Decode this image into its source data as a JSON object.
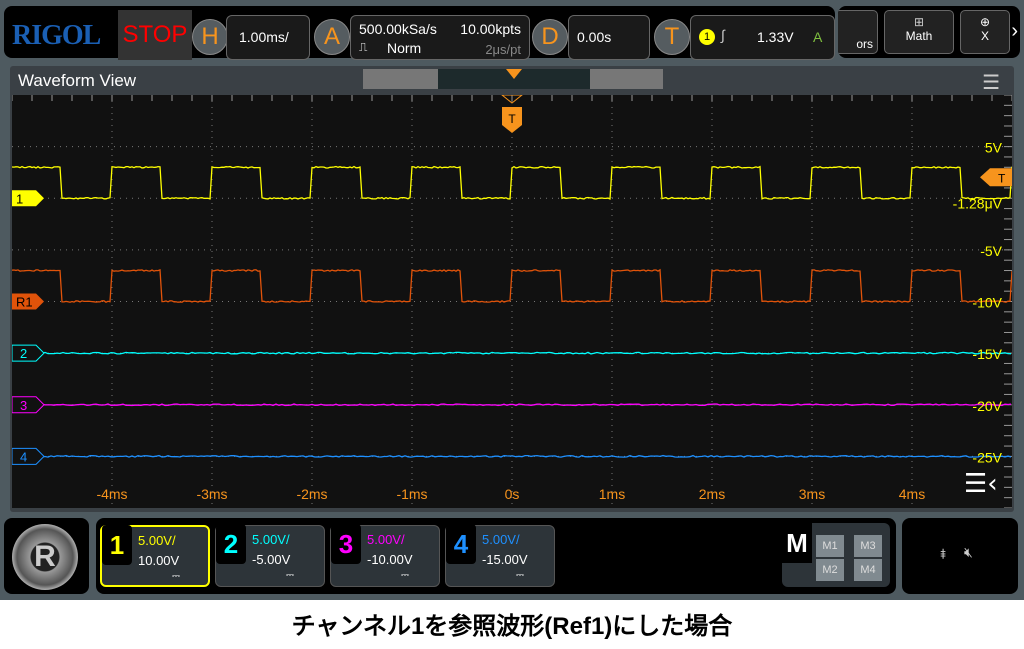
{
  "header": {
    "logo": "RIGOL",
    "run_state": "STOP",
    "h_label": "H",
    "timebase": "1.00ms/",
    "a_label": "A",
    "sample_rate": "500.00kSa/s",
    "memory_depth": "10.00kpts",
    "acq_mode": "Norm",
    "sample_interval": "2μs/pt",
    "d_label": "D",
    "delay": "0.00s",
    "t_label": "T",
    "trigger_source": "1",
    "trigger_level": "1.33V",
    "trigger_status": "A",
    "right_buttons": [
      "ors",
      "Math",
      "X"
    ]
  },
  "waveform_view": {
    "title": "Waveform View",
    "trigger_marker": "T",
    "ch1_label": "1",
    "ref_label": "R1",
    "ch2_label": "2",
    "ch3_label": "3",
    "ch4_label": "4",
    "trigger_level_label": "-1.28μV",
    "volt_labels": [
      "5V",
      "-5V",
      "-10V",
      "-15V",
      "-20V",
      "-25V"
    ],
    "time_labels": [
      "-4ms",
      "-3ms",
      "-2ms",
      "-1ms",
      "0s",
      "1ms",
      "2ms",
      "3ms",
      "4ms"
    ]
  },
  "channels": [
    {
      "num": "1",
      "scale": "5.00V/",
      "offset": "10.00V",
      "coupling": "DC",
      "color": "#ffff00",
      "active": true
    },
    {
      "num": "2",
      "scale": "5.00V/",
      "offset": "-5.00V",
      "coupling": "DC",
      "color": "#00ffff"
    },
    {
      "num": "3",
      "scale": "5.00V/",
      "offset": "-10.00V",
      "coupling": "DC",
      "color": "#ff00ff"
    },
    {
      "num": "4",
      "scale": "5.00V/",
      "offset": "-15.00V",
      "coupling": "DC",
      "color": "#1e90ff"
    }
  ],
  "ref_color": "#e0530a",
  "math": {
    "label": "M",
    "buttons": [
      "M1",
      "M3",
      "M2",
      "M4"
    ]
  },
  "status_icons": [
    "usb-icon",
    "speaker-muted-icon"
  ],
  "signal": {
    "period_ms": 1,
    "high_V": 3,
    "low_V": 0,
    "duty": 0.5
  },
  "caption": "チャンネル1を参照波形(Ref1)にした場合"
}
